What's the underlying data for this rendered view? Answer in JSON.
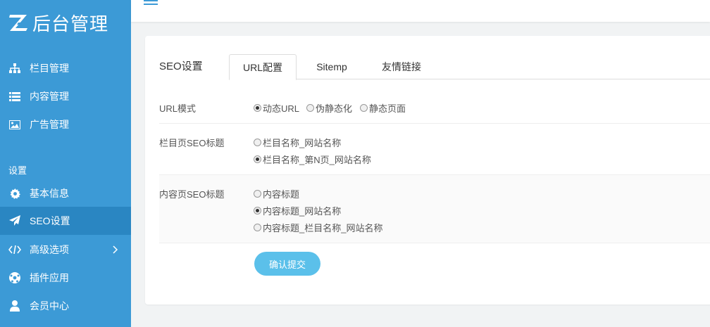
{
  "logo": {
    "text": "后台管理"
  },
  "sidebar": {
    "items": [
      {
        "label": "栏目管理",
        "icon": "sitemap-icon"
      },
      {
        "label": "内容管理",
        "icon": "list-icon"
      },
      {
        "label": "广告管理",
        "icon": "image-icon"
      }
    ],
    "section_label": "设置",
    "settings_items": [
      {
        "label": "基本信息",
        "icon": "gear-icon"
      },
      {
        "label": "SEO设置",
        "icon": "paper-plane-icon",
        "active": true
      },
      {
        "label": "高级选项",
        "icon": "code-icon"
      },
      {
        "label": "插件应用",
        "icon": "soccer-ball-icon"
      },
      {
        "label": "会员中心",
        "icon": "user-icon"
      }
    ]
  },
  "card": {
    "title": "SEO设置",
    "tabs": [
      {
        "label": "URL配置",
        "active": true
      },
      {
        "label": "Sitemp"
      },
      {
        "label": "友情链接"
      }
    ]
  },
  "form": {
    "url_mode": {
      "label": "URL模式",
      "options": [
        "动态URL",
        "伪静态化",
        "静态页面"
      ],
      "selected": 0
    },
    "column_title": {
      "label": "栏目页SEO标题",
      "options": [
        "栏目名称_网站名称",
        "栏目名称_第N页_网站名称"
      ],
      "selected": 1
    },
    "content_title": {
      "label": "内容页SEO标题",
      "options": [
        "内容标题",
        "内容标题_网站名称",
        "内容标题_栏目名称_网站名称"
      ],
      "selected": 1
    },
    "submit_label": "确认提交"
  },
  "colors": {
    "sidebar": "#3c9ad6",
    "sidebar_active": "#2a86c2",
    "button": "#5bc0ea"
  }
}
